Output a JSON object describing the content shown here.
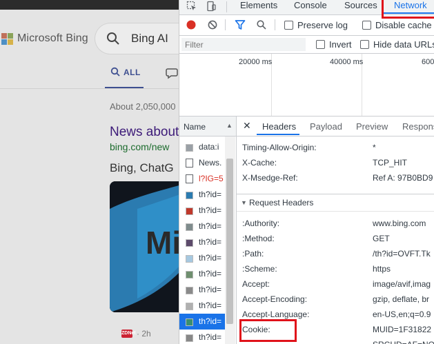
{
  "bing": {
    "logo_text": "Microsoft Bing",
    "search_query": "Bing AI",
    "tab_all_label": "ALL",
    "result_count": "About 2,050,000",
    "result_title": "News about",
    "result_url": "bing.com/new",
    "news_heading": "Bing, ChatG",
    "news_card_text": "Mi",
    "news_source_logo": "ZDNet",
    "news_age": "· 2h",
    "colors": {
      "link_visited": "#3c1a78",
      "url_green": "#1c6b2d",
      "brand_blue": "#3e4f90"
    }
  },
  "devtools": {
    "tabs": [
      "Elements",
      "Console",
      "Sources",
      "Network"
    ],
    "active_tab": "Network",
    "toolbar": {
      "preserve_log": "Preserve log",
      "disable_cache": "Disable cache"
    },
    "filter": {
      "placeholder": "Filter",
      "invert": "Invert",
      "hide_data_urls": "Hide data URLs"
    },
    "timeline": {
      "ticks": [
        "20000 ms",
        "40000 ms",
        "600"
      ]
    },
    "name_column_header": "Name",
    "requests": [
      {
        "name": "data:i",
        "icon": "image-icon"
      },
      {
        "name": "News.",
        "icon": "document-icon"
      },
      {
        "name": "l?IG=5",
        "icon": "document-icon",
        "error": true
      },
      {
        "name": "th?id=",
        "icon": "image-icon"
      },
      {
        "name": "th?id=",
        "icon": "image-icon"
      },
      {
        "name": "th?id=",
        "icon": "image-icon"
      },
      {
        "name": "th?id=",
        "icon": "image-icon"
      },
      {
        "name": "th?id=",
        "icon": "image-icon"
      },
      {
        "name": "th?id=",
        "icon": "image-icon"
      },
      {
        "name": "th?id=",
        "icon": "image-icon"
      },
      {
        "name": "th?id=",
        "icon": "image-icon"
      },
      {
        "name": "th?id=",
        "icon": "image-icon",
        "selected": true
      },
      {
        "name": "th?id=",
        "icon": "image-icon"
      }
    ],
    "detail_tabs": [
      "Headers",
      "Payload",
      "Preview",
      "Respons"
    ],
    "active_detail_tab": "Headers",
    "response_headers": [
      {
        "name": "Timing-Allow-Origin:",
        "value": "*"
      },
      {
        "name": "X-Cache:",
        "value": "TCP_HIT"
      },
      {
        "name": "X-Msedge-Ref:",
        "value": "Ref A: 97B0BD9"
      }
    ],
    "request_headers_title": "Request Headers",
    "request_headers": [
      {
        "name": ":Authority:",
        "value": "www.bing.com"
      },
      {
        "name": ":Method:",
        "value": "GET"
      },
      {
        "name": ":Path:",
        "value": "/th?id=OVFT.Tk"
      },
      {
        "name": ":Scheme:",
        "value": "https"
      },
      {
        "name": "Accept:",
        "value": "image/avif,imag"
      },
      {
        "name": "Accept-Encoding:",
        "value": "gzip, deflate, br"
      },
      {
        "name": "Accept-Language:",
        "value": "en-US,en;q=0.9"
      },
      {
        "name": "Cookie:",
        "value": "MUID=1F31822"
      },
      {
        "name": "",
        "value": "SRCHD=AF=NO"
      }
    ],
    "colors": {
      "accent": "#1a73e8",
      "record_red": "#d93025",
      "highlight_red": "#e0121a"
    }
  }
}
